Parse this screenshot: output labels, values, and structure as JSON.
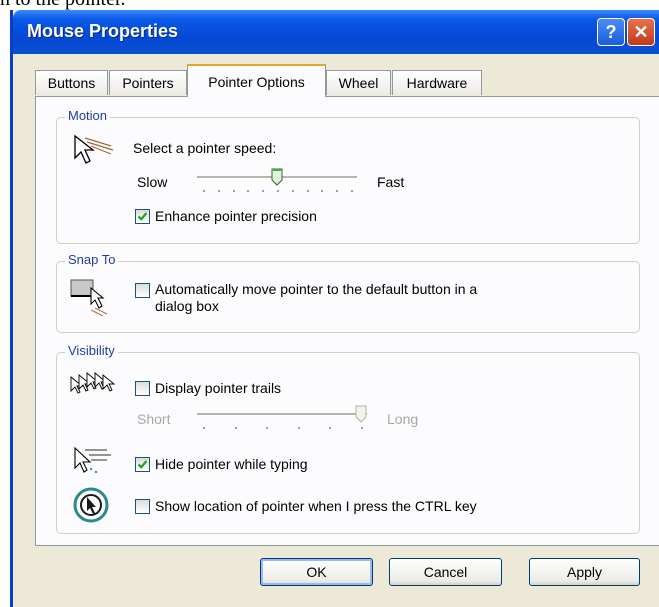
{
  "background_text": "n to the pointer.",
  "window": {
    "title": "Mouse Properties",
    "help_label": "?",
    "close_label": "✕"
  },
  "tabs": [
    {
      "label": "Buttons",
      "active": false
    },
    {
      "label": "Pointers",
      "active": false
    },
    {
      "label": "Pointer Options",
      "active": true
    },
    {
      "label": "Wheel",
      "active": false
    },
    {
      "label": "Hardware",
      "active": false
    }
  ],
  "motion": {
    "group_label": "Motion",
    "icon": "pointer-speed-icon",
    "speed_label": "Select a pointer speed:",
    "slow_label": "Slow",
    "fast_label": "Fast",
    "speed_level": 0.5,
    "enhance_label": "Enhance pointer precision",
    "enhance_checked": true
  },
  "snap": {
    "group_label": "Snap To",
    "icon": "snap-to-icon",
    "label_line1": "Automatically move pointer to the default button in a",
    "label_line2": "dialog box",
    "checked": false
  },
  "visibility": {
    "group_label": "Visibility",
    "trails_icon": "pointer-trails-icon",
    "trails_label": "Display pointer trails",
    "trails_checked": false,
    "short_label": "Short",
    "long_label": "Long",
    "trails_level": 1.0,
    "hide_icon": "hide-pointer-icon",
    "hide_label": "Hide pointer while typing",
    "hide_checked": true,
    "ctrl_icon": "pointer-location-icon",
    "ctrl_label": "Show location of pointer when I press the CTRL key",
    "ctrl_checked": false
  },
  "buttons": {
    "ok": "OK",
    "cancel": "Cancel",
    "apply": "Apply"
  },
  "colors": {
    "titlebar": "#0548d6",
    "dialog_bg": "#ece9d8",
    "checkmark": "#21a121",
    "group_label": "#1e3ea0"
  }
}
